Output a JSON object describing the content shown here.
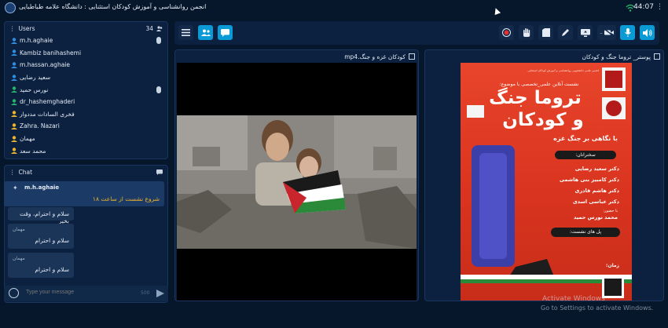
{
  "topbar": {
    "title": "انجمن روانشناسی و آموزش کودکان استثنایی : دانشگاه علامه طباطبایی",
    "clock": "44:07"
  },
  "users": {
    "header": "Users",
    "count": "34",
    "list": [
      {
        "name": "m.h.aghaie",
        "color": "#2f8ee0",
        "mic": true
      },
      {
        "name": "Kambiz banihashemi",
        "color": "#2f8ee0",
        "mic": false
      },
      {
        "name": "m.hassan.aghaie",
        "color": "#2f8ee0",
        "mic": false
      },
      {
        "name": "سعید رضایی",
        "color": "#2f8ee0",
        "mic": false
      },
      {
        "name": "نورس حمید",
        "color": "#27b36a",
        "mic": true
      },
      {
        "name": "dr_hashemghaderi",
        "color": "#27b36a",
        "mic": false
      },
      {
        "name": "فخری السادات مددوار",
        "color": "#f0b429",
        "mic": false
      },
      {
        "name": "Zahra. Nazari",
        "color": "#f0b429",
        "mic": false
      },
      {
        "name": "مهمان",
        "color": "#f0b429",
        "mic": false
      },
      {
        "name": "محمد سعد",
        "color": "#f0b429",
        "mic": false
      }
    ]
  },
  "chat": {
    "header": "Chat",
    "pinned": {
      "user": "m.h.aghaie",
      "message": "شروع نشست از ساعت ۱۸"
    },
    "messages": [
      {
        "user": "",
        "text": "سلام و احترام، وقت بخیر"
      },
      {
        "user": "مهمان",
        "text": "سلام و احترام"
      },
      {
        "user": "مهمان",
        "text": "سلام و احترام"
      }
    ],
    "input_placeholder": "Type your message",
    "char_limit": "500"
  },
  "toolbar": {
    "left_buttons": [
      "menu-icon",
      "users-icon",
      "chat-icon"
    ],
    "right_buttons": [
      "record-icon",
      "hand-icon",
      "file-icon",
      "pen-icon",
      "screen-share-icon",
      "camera-off-icon",
      "mic-icon",
      "speaker-icon"
    ]
  },
  "video_panel": {
    "title": "کودکان غزه و جنگ.mp4"
  },
  "poster_panel": {
    "title": "پوستر_ تروما جنگ و کودکان",
    "poster": {
      "intro": "انجمن علمی دانشجویی روانشناسی و آموزش کودکان استثنایی",
      "subtitle": "نشست آنلاین علمی_تخصصی با موضوع:",
      "main_title_1": "تروما جنگ",
      "main_title_2": "و کودکان",
      "tagline": "با نگاهی بر جنگ غزه",
      "speakers_label": "سخنرانان:",
      "speakers": [
        "دکتر سعید رضایی",
        "دکتر کامبیز بنی هاشمی",
        "دکتر هاشم قادری",
        "دکتر عباسی اسدی"
      ],
      "host_label": "با حضور:",
      "host": "محمد نورس حمید",
      "link_label": "پل های نشست:",
      "time_label": "زمان:"
    }
  },
  "watermark": {
    "line1": "Activate Windows",
    "line2": "Go to Settings to activate Windows."
  }
}
